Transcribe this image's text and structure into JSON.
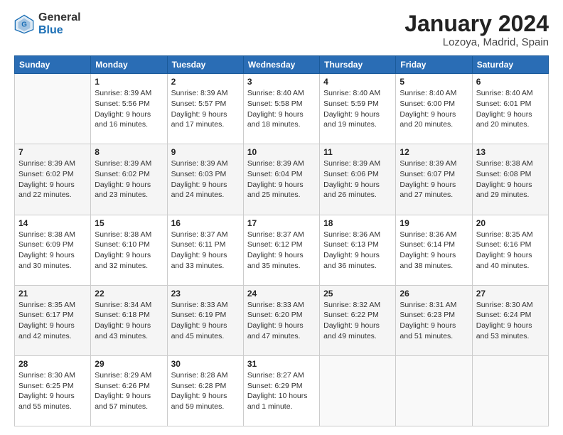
{
  "logo": {
    "general": "General",
    "blue": "Blue"
  },
  "title": "January 2024",
  "location": "Lozoya, Madrid, Spain",
  "days_of_week": [
    "Sunday",
    "Monday",
    "Tuesday",
    "Wednesday",
    "Thursday",
    "Friday",
    "Saturday"
  ],
  "weeks": [
    [
      {
        "day": "",
        "info": ""
      },
      {
        "day": "1",
        "info": "Sunrise: 8:39 AM\nSunset: 5:56 PM\nDaylight: 9 hours\nand 16 minutes."
      },
      {
        "day": "2",
        "info": "Sunrise: 8:39 AM\nSunset: 5:57 PM\nDaylight: 9 hours\nand 17 minutes."
      },
      {
        "day": "3",
        "info": "Sunrise: 8:40 AM\nSunset: 5:58 PM\nDaylight: 9 hours\nand 18 minutes."
      },
      {
        "day": "4",
        "info": "Sunrise: 8:40 AM\nSunset: 5:59 PM\nDaylight: 9 hours\nand 19 minutes."
      },
      {
        "day": "5",
        "info": "Sunrise: 8:40 AM\nSunset: 6:00 PM\nDaylight: 9 hours\nand 20 minutes."
      },
      {
        "day": "6",
        "info": "Sunrise: 8:40 AM\nSunset: 6:01 PM\nDaylight: 9 hours\nand 20 minutes."
      }
    ],
    [
      {
        "day": "7",
        "info": "Sunrise: 8:39 AM\nSunset: 6:02 PM\nDaylight: 9 hours\nand 22 minutes."
      },
      {
        "day": "8",
        "info": "Sunrise: 8:39 AM\nSunset: 6:02 PM\nDaylight: 9 hours\nand 23 minutes."
      },
      {
        "day": "9",
        "info": "Sunrise: 8:39 AM\nSunset: 6:03 PM\nDaylight: 9 hours\nand 24 minutes."
      },
      {
        "day": "10",
        "info": "Sunrise: 8:39 AM\nSunset: 6:04 PM\nDaylight: 9 hours\nand 25 minutes."
      },
      {
        "day": "11",
        "info": "Sunrise: 8:39 AM\nSunset: 6:06 PM\nDaylight: 9 hours\nand 26 minutes."
      },
      {
        "day": "12",
        "info": "Sunrise: 8:39 AM\nSunset: 6:07 PM\nDaylight: 9 hours\nand 27 minutes."
      },
      {
        "day": "13",
        "info": "Sunrise: 8:38 AM\nSunset: 6:08 PM\nDaylight: 9 hours\nand 29 minutes."
      }
    ],
    [
      {
        "day": "14",
        "info": "Sunrise: 8:38 AM\nSunset: 6:09 PM\nDaylight: 9 hours\nand 30 minutes."
      },
      {
        "day": "15",
        "info": "Sunrise: 8:38 AM\nSunset: 6:10 PM\nDaylight: 9 hours\nand 32 minutes."
      },
      {
        "day": "16",
        "info": "Sunrise: 8:37 AM\nSunset: 6:11 PM\nDaylight: 9 hours\nand 33 minutes."
      },
      {
        "day": "17",
        "info": "Sunrise: 8:37 AM\nSunset: 6:12 PM\nDaylight: 9 hours\nand 35 minutes."
      },
      {
        "day": "18",
        "info": "Sunrise: 8:36 AM\nSunset: 6:13 PM\nDaylight: 9 hours\nand 36 minutes."
      },
      {
        "day": "19",
        "info": "Sunrise: 8:36 AM\nSunset: 6:14 PM\nDaylight: 9 hours\nand 38 minutes."
      },
      {
        "day": "20",
        "info": "Sunrise: 8:35 AM\nSunset: 6:16 PM\nDaylight: 9 hours\nand 40 minutes."
      }
    ],
    [
      {
        "day": "21",
        "info": "Sunrise: 8:35 AM\nSunset: 6:17 PM\nDaylight: 9 hours\nand 42 minutes."
      },
      {
        "day": "22",
        "info": "Sunrise: 8:34 AM\nSunset: 6:18 PM\nDaylight: 9 hours\nand 43 minutes."
      },
      {
        "day": "23",
        "info": "Sunrise: 8:33 AM\nSunset: 6:19 PM\nDaylight: 9 hours\nand 45 minutes."
      },
      {
        "day": "24",
        "info": "Sunrise: 8:33 AM\nSunset: 6:20 PM\nDaylight: 9 hours\nand 47 minutes."
      },
      {
        "day": "25",
        "info": "Sunrise: 8:32 AM\nSunset: 6:22 PM\nDaylight: 9 hours\nand 49 minutes."
      },
      {
        "day": "26",
        "info": "Sunrise: 8:31 AM\nSunset: 6:23 PM\nDaylight: 9 hours\nand 51 minutes."
      },
      {
        "day": "27",
        "info": "Sunrise: 8:30 AM\nSunset: 6:24 PM\nDaylight: 9 hours\nand 53 minutes."
      }
    ],
    [
      {
        "day": "28",
        "info": "Sunrise: 8:30 AM\nSunset: 6:25 PM\nDaylight: 9 hours\nand 55 minutes."
      },
      {
        "day": "29",
        "info": "Sunrise: 8:29 AM\nSunset: 6:26 PM\nDaylight: 9 hours\nand 57 minutes."
      },
      {
        "day": "30",
        "info": "Sunrise: 8:28 AM\nSunset: 6:28 PM\nDaylight: 9 hours\nand 59 minutes."
      },
      {
        "day": "31",
        "info": "Sunrise: 8:27 AM\nSunset: 6:29 PM\nDaylight: 10 hours\nand 1 minute."
      },
      {
        "day": "",
        "info": ""
      },
      {
        "day": "",
        "info": ""
      },
      {
        "day": "",
        "info": ""
      }
    ]
  ]
}
